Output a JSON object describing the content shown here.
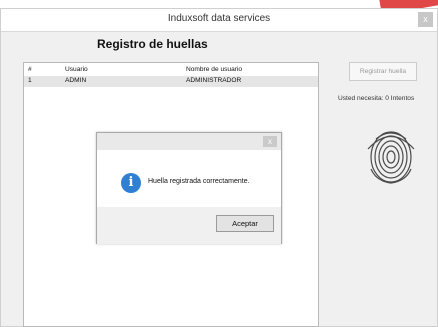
{
  "window": {
    "title": "Induxsoft data services",
    "close_glyph": "x"
  },
  "panel": {
    "heading": "Registro de huellas"
  },
  "grid": {
    "columns": [
      "#",
      "Usuario",
      "Nombre de usuario"
    ],
    "rows": [
      {
        "n": "1",
        "user": "ADMIN",
        "name": "ADMINISTRADOR"
      }
    ]
  },
  "right": {
    "register_button": "Registrar huella",
    "status": "Usted necesita: 0 Intentos"
  },
  "dialog": {
    "close_glyph": "x",
    "icon_glyph": "i",
    "message": "Huella registrada correctamente.",
    "ok_label": "Aceptar"
  },
  "colors": {
    "info_blue": "#2f7fd3",
    "top_stroke": "#e04848"
  },
  "icons": [
    "close-icon",
    "info-icon",
    "fingerprint-icon"
  ]
}
